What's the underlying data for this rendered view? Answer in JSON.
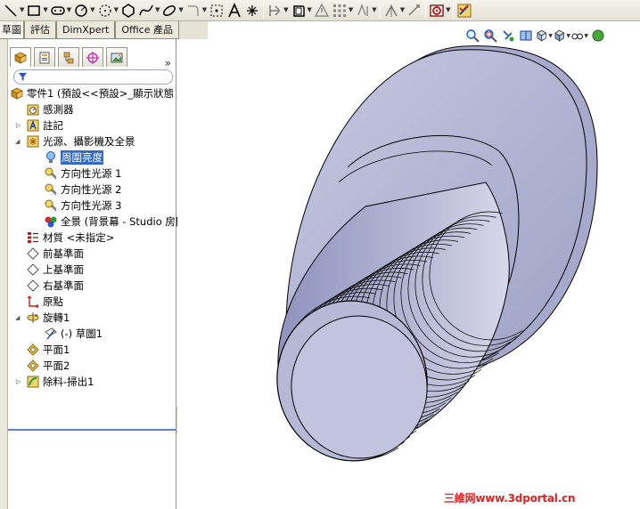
{
  "toolbar": {
    "icons": [
      "line-icon",
      "rectangle-icon",
      "slot-icon",
      "circle-icon",
      "arc-icon",
      "polygon-icon",
      "spline-icon",
      "ellipse-icon",
      "fillet-icon",
      "point-icon",
      "text-icon",
      "centerline-icon",
      "trim-icon",
      "offset-icon",
      "warning-icon",
      "grid-icon",
      "mirror-icon",
      "pattern-icon",
      "relation-icon",
      "dimension-icon",
      "repair-icon",
      "exit-sketch-icon"
    ]
  },
  "tabs": [
    "草圖",
    "評估",
    "DimXpert",
    "Office 產品"
  ],
  "panel": {
    "collapse_label": "»",
    "filter_icon": "filter-icon"
  },
  "tree": [
    {
      "label": "零件1  (預設<<預設>_顯示狀態",
      "icon": "part-icon"
    },
    {
      "label": "感測器",
      "icon": "sensor-icon"
    },
    {
      "label": "註記",
      "icon": "annotation-icon"
    },
    {
      "label": "光源、攝影機及全景",
      "icon": "lights-icon"
    },
    {
      "label": "周圍亮度",
      "icon": "bulb-icon"
    },
    {
      "label": "方向性光源 1",
      "icon": "directional-light-icon"
    },
    {
      "label": "方向性光源 2",
      "icon": "directional-light-icon"
    },
    {
      "label": "方向性光源 3",
      "icon": "directional-light-icon"
    },
    {
      "label": "全景 (背景幕 - Studio 房間",
      "icon": "scene-icon"
    },
    {
      "label": "材質 <未指定>",
      "icon": "material-icon"
    },
    {
      "label": "前基準面",
      "icon": "plane-icon"
    },
    {
      "label": "上基準面",
      "icon": "plane-icon"
    },
    {
      "label": "右基準面",
      "icon": "plane-icon"
    },
    {
      "label": "原點",
      "icon": "origin-icon"
    },
    {
      "label": "旋轉1",
      "icon": "revolve-icon"
    },
    {
      "label": "(-) 草圖1",
      "icon": "sketch-icon"
    },
    {
      "label": "平面1",
      "icon": "ref-plane-icon"
    },
    {
      "label": "平面2",
      "icon": "ref-plane-icon"
    },
    {
      "label": "除料-掃出1",
      "icon": "swept-cut-icon"
    }
  ],
  "view_tools": [
    "zoom-to-fit-icon",
    "zoom-area-icon",
    "previous-view-icon",
    "section-view-icon",
    "view-orientation-icon",
    "display-style-icon",
    "hide-show-icon",
    "appearance-icon"
  ],
  "watermark": "三維网www.3dportal.cn",
  "colors": {
    "selection": "#316ac5",
    "model_face": "#b7b9d6",
    "model_edge": "#000000",
    "watermark": "#dd2222"
  }
}
